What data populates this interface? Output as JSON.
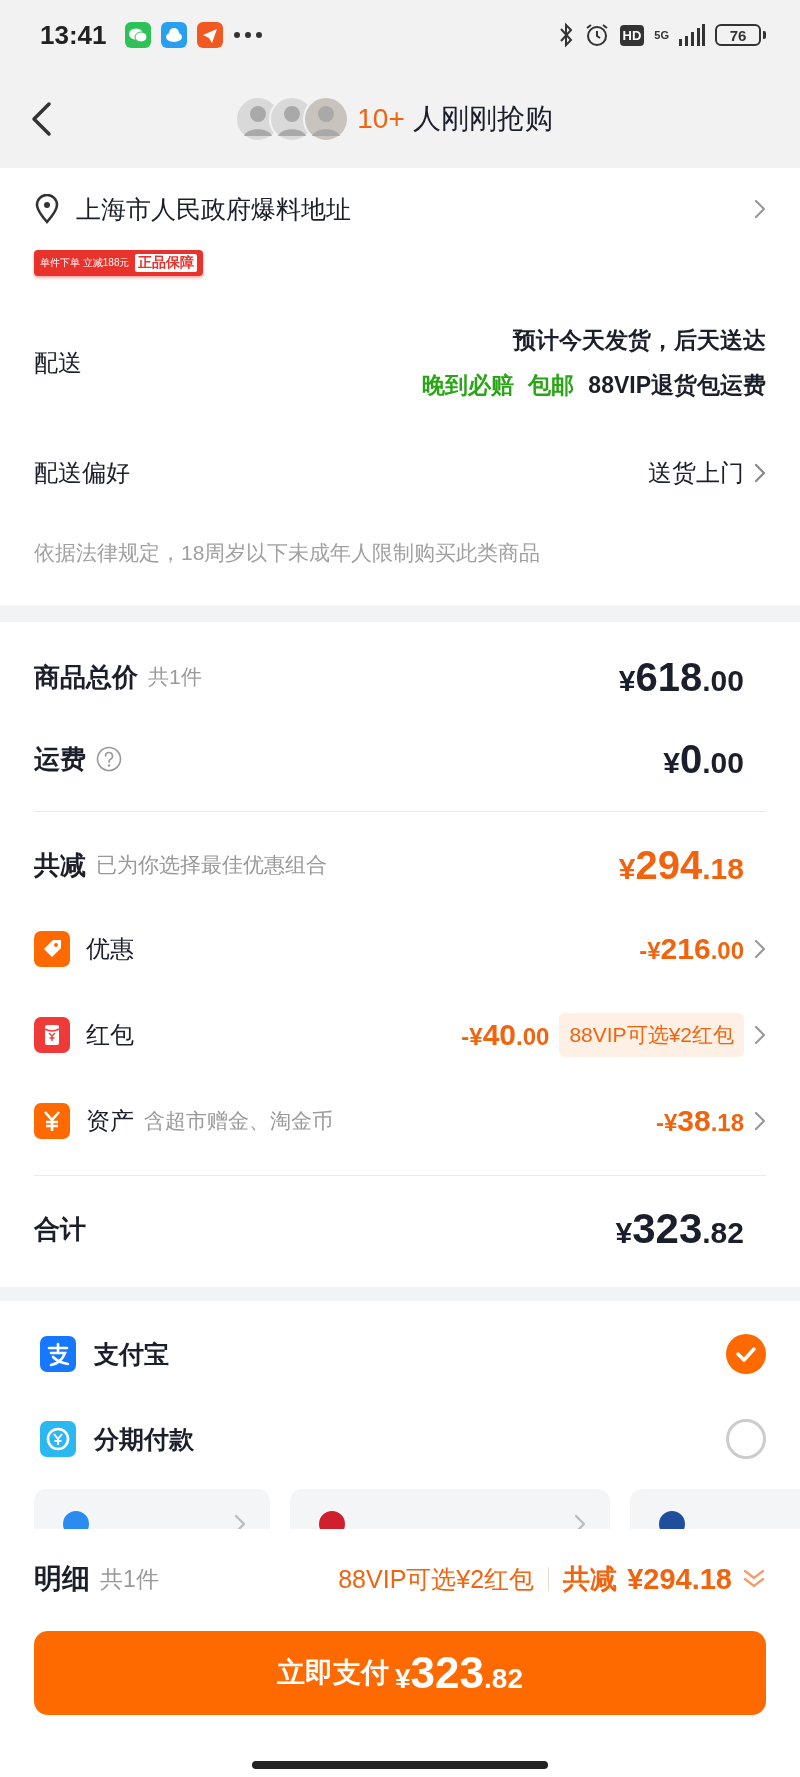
{
  "status_bar": {
    "time": "13:41",
    "hd": "HD",
    "network": "5G",
    "battery": "76"
  },
  "header": {
    "count": "10+",
    "text": "人刚刚抢购"
  },
  "address": {
    "text": "上海市人民政府爆料地址"
  },
  "promo_banner": {
    "texts": [
      "单件下单 立减188元",
      "正品保障"
    ]
  },
  "delivery": {
    "label": "配送",
    "estimate": "预计今天发货，后天送达",
    "tags": [
      {
        "text": "晚到必赔",
        "color": "#2aa515"
      },
      {
        "text": "包邮",
        "color": "#2aa515"
      },
      {
        "text": "88VIP退货包运费",
        "color": "#1b1f2b"
      }
    ]
  },
  "preference": {
    "label": "配送偏好",
    "value": "送货上门"
  },
  "notice": "依据法律规定，18周岁以下未成年人限制购买此类商品",
  "summary": {
    "rows": [
      {
        "kind": "total",
        "label": "商品总价",
        "note": "共1件",
        "price": "¥618.00"
      },
      {
        "kind": "fee",
        "label": "运费",
        "price": "¥0.00"
      },
      {
        "kind": "divider"
      },
      {
        "kind": "saving",
        "label": "共减",
        "note": "已为你选择最佳优惠组合",
        "price": "¥294.18"
      },
      {
        "kind": "discount",
        "label": "优惠",
        "price": "-¥216.00"
      },
      {
        "kind": "discount",
        "label": "红包",
        "price": "-¥40.00",
        "badge": "88VIP可选¥2红包"
      },
      {
        "kind": "discount",
        "label": "资产",
        "note": "含超市赠金、淘金币",
        "price": "-¥38.18"
      },
      {
        "kind": "divider"
      },
      {
        "kind": "grand",
        "label": "合计",
        "price": "¥323.82"
      }
    ]
  },
  "payment": {
    "methods": [
      {
        "label": "支付宝",
        "selected": true
      },
      {
        "label": "分期付款",
        "selected": false
      }
    ],
    "cards": [
      {
        "color": "#2a8cf0"
      },
      {
        "color": "#d0202e"
      },
      {
        "color": "#1f4e9c"
      }
    ]
  },
  "checkout": {
    "label": "明细",
    "count": "共1件",
    "vip": "88VIP可选¥2红包",
    "saving_label": "共减",
    "saving": "¥294.18",
    "button_label": "立即支付",
    "button_price": "¥323.82"
  }
}
